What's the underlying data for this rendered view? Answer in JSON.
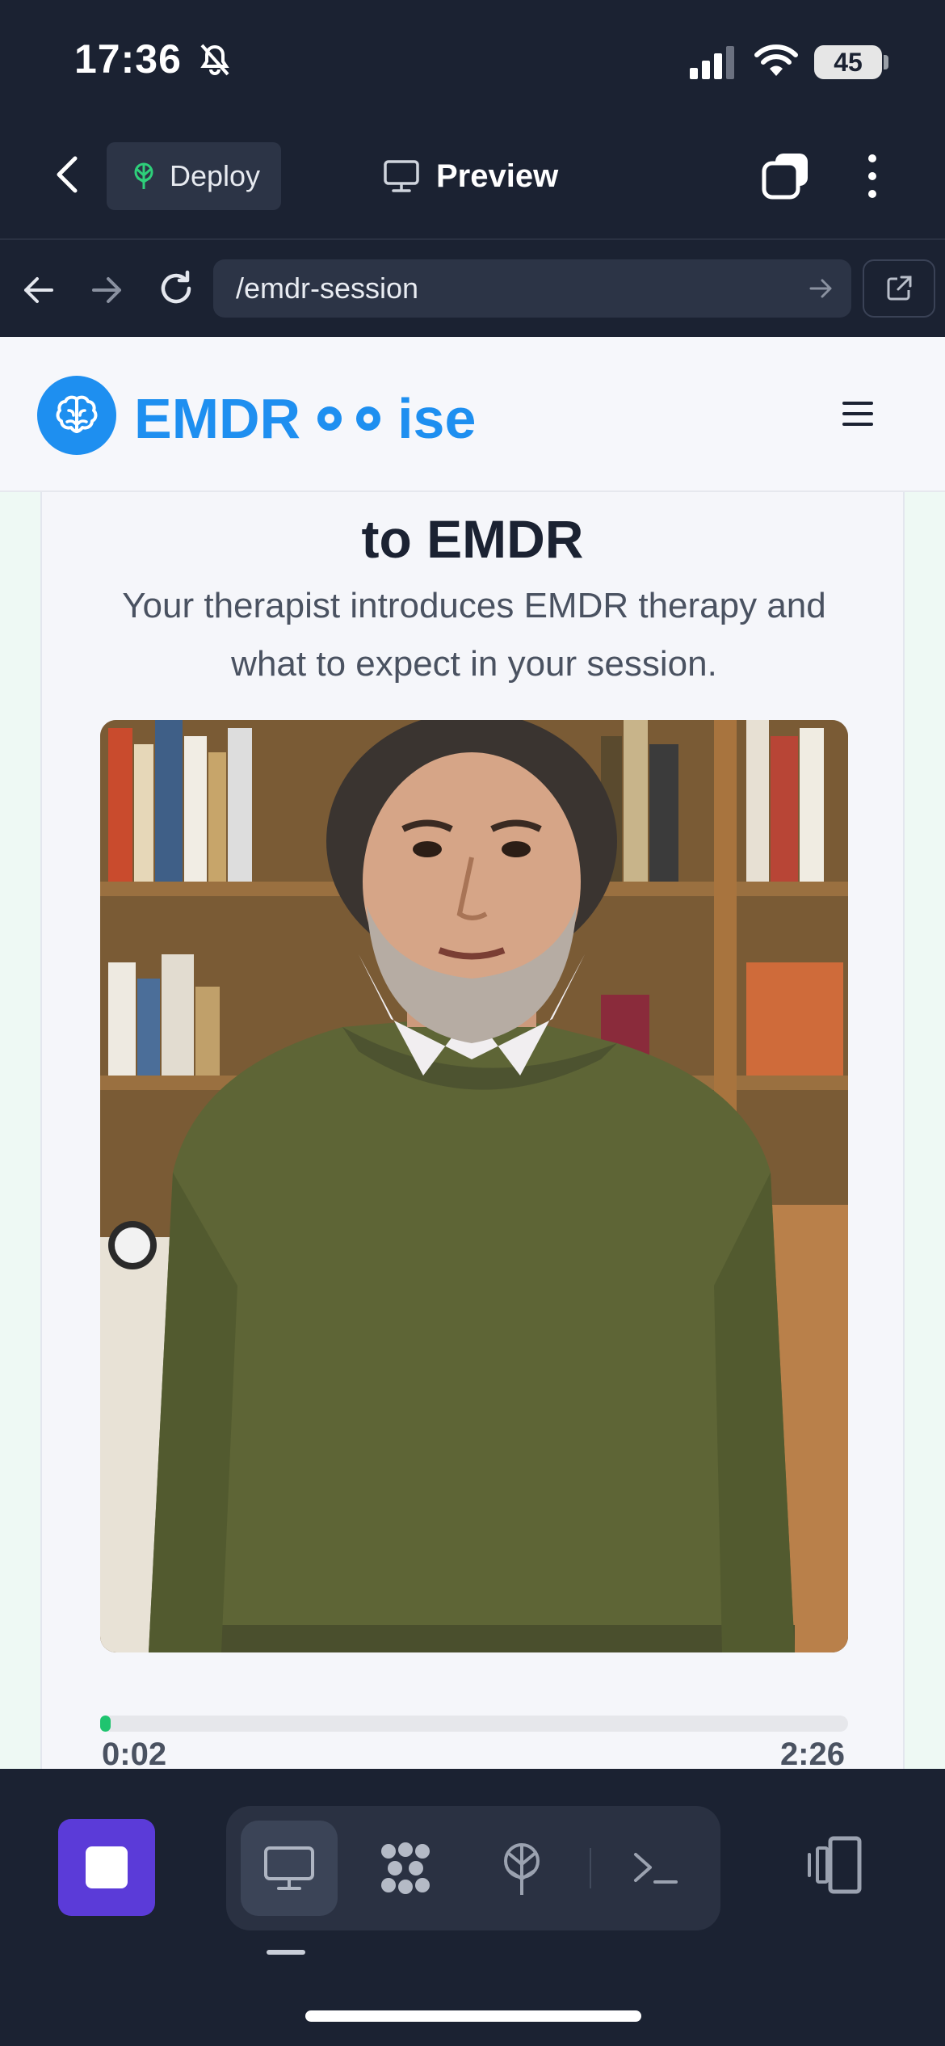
{
  "status": {
    "time": "17:36",
    "battery": "45"
  },
  "app_bar": {
    "deploy_label": "Deploy",
    "preview_label": "Preview"
  },
  "browser": {
    "url": "/emdr-session"
  },
  "site": {
    "brand_left": "EMDR",
    "brand_right": "ise"
  },
  "card": {
    "title": "to EMDR",
    "subtitle": "Your therapist introduces EMDR therapy and what to expect in your session."
  },
  "player": {
    "current_time": "0:02",
    "total_time": "2:26",
    "progress_fraction": 0.014
  },
  "colors": {
    "accent_blue": "#1e8ff0",
    "progress_green": "#1fc46f",
    "stop_purple": "#5b3bd8",
    "chrome_dark": "#1b2232"
  },
  "icons": {
    "status": [
      "bell-off-icon",
      "signal-icon",
      "wifi-icon"
    ],
    "app_bar": [
      "chevron-left-icon",
      "deploy-tree-icon",
      "monitor-icon",
      "tabs-icon",
      "kebab-menu-icon"
    ],
    "url_bar": [
      "arrow-left-icon",
      "arrow-right-icon",
      "reload-icon",
      "arrow-go-icon",
      "external-link-icon"
    ],
    "site": [
      "brain-icon",
      "hamburger-icon"
    ],
    "toolbar": [
      "stop-icon",
      "monitor-icon",
      "grid-dots-icon",
      "deploy-tree-icon",
      "terminal-icon",
      "device-switch-icon"
    ]
  }
}
